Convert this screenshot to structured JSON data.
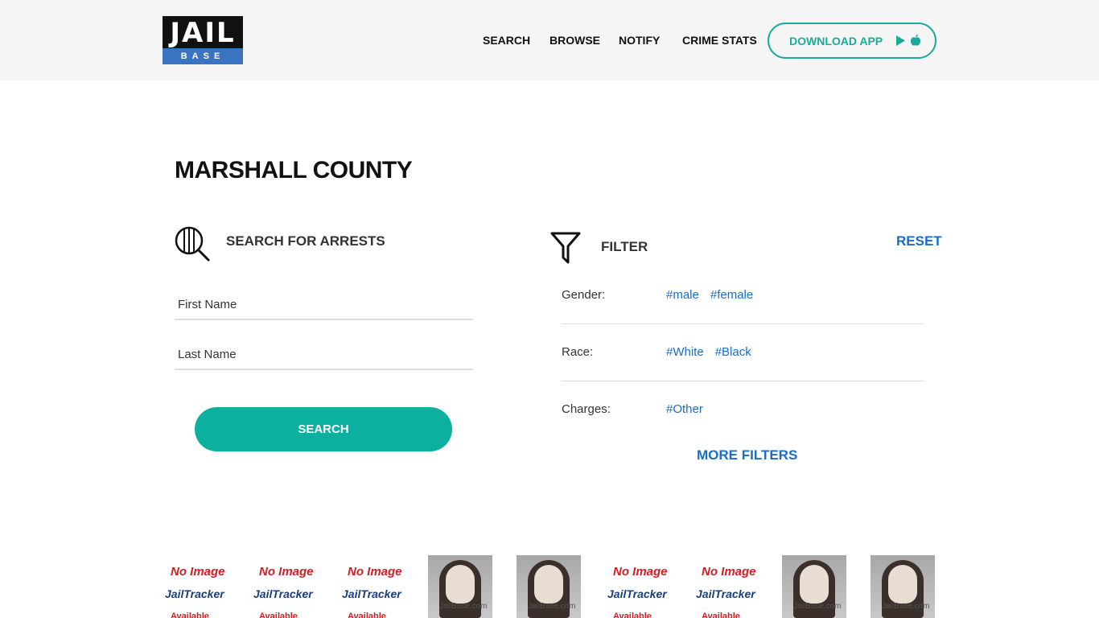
{
  "header": {
    "logo_top": "JAIL",
    "logo_bottom": "BASE",
    "nav": [
      "SEARCH",
      "BROWSE",
      "NOTIFY",
      "CRIME STATS"
    ],
    "download_label": "DOWNLOAD APP"
  },
  "page": {
    "title": "MARSHALL COUNTY"
  },
  "search": {
    "heading": "SEARCH FOR ARRESTS",
    "first_name_placeholder": "First Name",
    "last_name_placeholder": "Last Name",
    "button_label": "SEARCH"
  },
  "filter": {
    "heading": "FILTER",
    "reset_label": "RESET",
    "rows": [
      {
        "label": "Gender:",
        "tags": [
          "#male",
          "#female"
        ]
      },
      {
        "label": "Race:",
        "tags": [
          "#White",
          "#Black"
        ]
      },
      {
        "label": "Charges:",
        "tags": [
          "#Other"
        ]
      }
    ],
    "more_label": "MORE FILTERS"
  },
  "thumbnails": {
    "noimage_line1": "No Image",
    "noimage_line2": "JailTracker",
    "noimage_line3": "Available",
    "photo_watermark": "JailBase.com",
    "items": [
      "noimage",
      "noimage",
      "noimage",
      "photo",
      "photo",
      "noimage",
      "noimage",
      "photo",
      "photo"
    ]
  },
  "colors": {
    "accent_teal": "#0bb09f",
    "link_blue": "#1a6dc4",
    "logo_blue": "#3a74c0"
  }
}
